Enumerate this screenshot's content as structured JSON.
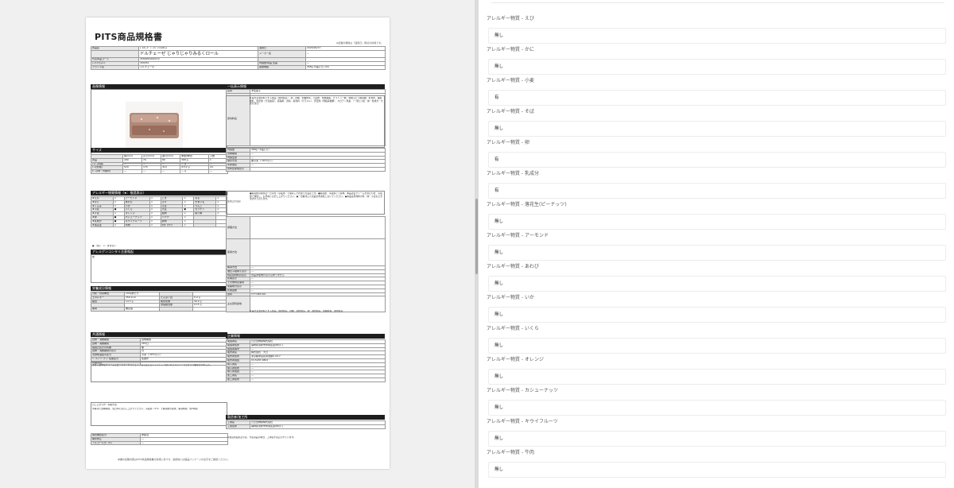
{
  "document": {
    "title": "PITS商品規格書",
    "header_note": "※記載の規格は「適用日」時点の情報です。",
    "header_rows": [
      {
        "l1": "商品名",
        "v1": "ﾄﾞﾙﾁｪｰｾﾞ ｼﾞｬﾘｼﾞｬﾘﾐﾙｸﾛｰﾙ",
        "l2": "適用日",
        "v2": "2025/09/17"
      },
      {
        "l1": "",
        "v1": "ドルチェーゼ じゃりじゃりみるくロール",
        "l2": "メーカー名",
        "v2": "―"
      },
      {
        "l1": "代表商品コード",
        "v1": "4589950000072",
        "l2": "",
        "v2": ""
      },
      {
        "l1": "ﾒｰｶｰｱｲﾃﾑｺｰﾄﾞ",
        "v1": "300031",
        "l2": "内容量/商品 企画",
        "v2": "―"
      },
      {
        "l1": "ブランド名",
        "v1": "ドルチェーゼ",
        "l2": "容量規格",
        "v2": "368g (1個入り) /24"
      }
    ],
    "sections": {
      "image": "画像情報",
      "size": "サイズ",
      "allergen": "アレルギー物質情報（★：推奨表示）",
      "contam": "アレルゲンコンタミ注意喚起",
      "nutrition": "栄養成分情報",
      "shared": "共通情報",
      "general": "一括表示情報",
      "company": "企業情報",
      "maker": "製造者/加工所"
    },
    "size_rows": [
      [
        "",
        "幅(mm)",
        "高さ(mm)",
        "奥行(mm)",
        "重量(単位)",
        "入数"
      ],
      [
        "商品",
        "180",
        "70",
        "80",
        "368 g",
        "1"
      ],
      [
        "ｲﾝﾅｰ(中箱)",
        "―",
        "―",
        "―",
        "― g",
        "―"
      ],
      [
        "ｹｰｽ(外箱)",
        "520",
        "170",
        "410",
        "9712 g",
        "24"
      ],
      [
        "ﾎﾞｰﾙ(中・外箱外)",
        "―",
        "―",
        "―",
        "― g",
        "―"
      ]
    ],
    "allergen_rows": [
      [
        "★えび",
        "×",
        "アーモンド",
        "×",
        "ごま",
        "×",
        "もも",
        "×"
      ],
      [
        "★かに",
        "×",
        "あわび",
        "×",
        "さけ",
        "×",
        "やまいも",
        "×"
      ],
      [
        "★くるみ",
        "×",
        "いか",
        "×",
        "さば",
        "×",
        "りんご",
        "×"
      ],
      [
        "★小麦",
        "●",
        "いくら",
        "×",
        "大豆",
        "●",
        "ゼラチン",
        "×"
      ],
      [
        "★そば",
        "×",
        "オレンジ",
        "×",
        "鶏肉",
        "×",
        "魚介類",
        "×"
      ],
      [
        "★卵",
        "●",
        "カシューナッツ",
        "×",
        "バナナ",
        "×",
        "",
        ""
      ],
      [
        "★乳成分",
        "●",
        "キウイフルーツ",
        "×",
        "豚肉",
        "×",
        "",
        ""
      ],
      [
        "★落花生",
        "×",
        "牛肉",
        "×",
        "ﾏｶﾀﾞﾐｱﾅｯﾂ",
        "×",
        "",
        ""
      ]
    ],
    "allergen_legend": "●：含む　×：含まない",
    "contam_text": "無",
    "nutrition_rows": [
      [
        "分析・計算単位",
        "100gあたり",
        "",
        ""
      ],
      [
        "エネルギー",
        "356 kcal",
        "たんぱく質",
        "5.9 g"
      ],
      [
        "脂質",
        "14.3 g",
        "炭水化物",
        "39.4 g"
      ],
      [
        "",
        "",
        "食塩相当量",
        "0.15 g"
      ],
      [
        "備考",
        "推定値",
        "",
        ""
      ]
    ],
    "shared_rows": [
      [
        "賞味・消費期限",
        "賞味期限"
      ],
      [
        "賞味・消費期間",
        "365日"
      ],
      [
        "製造日表示の有無",
        "無"
      ],
      [
        "賞味・消費期限の表示",
        "月"
      ],
      [
        "流通時温度帯区分",
        "冷凍（-18℃以下）"
      ],
      [
        "ﾊﾞｰｺｰﾄﾞﾊﾟｯｹｰｼﾞ在庫区分",
        "在庫外"
      ],
      [
        "商品特徴",
        ""
      ]
    ],
    "shared_feature": "あまく濃厚なクリームとロールケーキでシュッ、ほろほろとシャリシャリ甘いカラメルソースとザラメ糖をかけました。",
    "shared_note_label": "召し上がり方・利用方法",
    "shared_note": "半解凍で賞味期限、当日中にお召し上がりください。冷蔵庫（4℃）で解凍後の提供：解凍時間　約3時間",
    "shared_bottom": [
      [
        "保管推奨区分",
        "非該当"
      ],
      [
        "酸化防止",
        "―"
      ],
      [
        "アルコール分（%）",
        "―"
      ]
    ],
    "general_rows": [
      [
        "名称",
        "洋生菓子"
      ],
      [
        "原材料名",
        ""
      ]
    ],
    "ingredients": "乳等を主要原料とする食品（国内製造）、卵、砂糖、加糖卵黄、小麦粉、植物油脂、グラニュー糖、果糖ぶどう糖液糖、水あめ、脱脂粉乳、乳化剤（大豆由来）、膨張剤、香料、着色料（カラメル）、安定剤（増粘多糖類）、カロテン色素、（一部に小麦・卵・乳成分・大豆を含む）",
    "general_rows2": [
      [
        "内容量",
        "368g（1個入り）"
      ],
      [
        "賞味期限",
        "―"
      ],
      [
        "内容生産",
        "―"
      ],
      [
        "保存方法",
        "要冷凍（-18℃以下）"
      ],
      [
        "原産国名",
        "―"
      ],
      [
        "原料原産地表示",
        ""
      ]
    ],
    "caution_label": "使用上の注意",
    "caution_text": "●解凍後の提供は一日以内（冷蔵庫）で保存した状態での設定です。●解凍後、冷蔵庫にて賞味、本品は生クリームを含むため、冷蔵庫で保管し、お早めにお召し上がりください。●一旦解凍した商品を再凍結しないでください。●本品は原材料の乳・卵・小麦などが含まれております。",
    "general_rows3": [
      [
        "調理方法",
        ""
      ],
      [
        "使用方法",
        ""
      ],
      [
        "解凍方法",
        "―"
      ],
      [
        "遺伝子組換え表示",
        "―"
      ],
      [
        "特定原材料の表示",
        "食品添加物の表示はありません"
      ],
      [
        "乳等表示",
        "―"
      ],
      [
        "その他特定事項",
        "―"
      ],
      [
        "栄養成分表示",
        "―"
      ],
      [
        "乳酸菌数",
        "―"
      ],
      [
        "原料",
        "TYYY.MM.DD"
      ],
      [
        "主な原料産地",
        ""
      ]
    ],
    "origin_text": "乳等を主要原料とする食品：国内製造、砂糖：国内製造、卵：国内製造、加糖卵黄：国内製造",
    "company_rows": [
      [
        "製造者名",
        "日之出物産株式会社"
      ],
      [
        "製造者住所",
        "静岡県浜松市中央区苗木町1丁"
      ],
      [
        "製造者番号",
        "―"
      ],
      [
        "販売者名",
        "株式会社　大日"
      ],
      [
        "販売者住所",
        "東京都豊島区南池袋2-29-7"
      ],
      [
        "販売者電話",
        "03-5287-9802"
      ],
      [
        "輸入者名",
        "―"
      ],
      [
        "輸入者住所",
        "―"
      ],
      [
        "輸入者電話",
        "―"
      ],
      [
        "加工者名",
        "―"
      ],
      [
        "加工者住所",
        "―"
      ]
    ],
    "maker_rows": [
      [
        "工場名",
        "日之出物産株式会社"
      ],
      [
        "工場住所",
        "静岡県浜松市中央区苗木町1丁"
      ]
    ],
    "maker_note": "※製造所固有記号は、代表商品の場合、工場名が表記されています。",
    "footer": "本書の記載内容はPITS商品規格書の情報に基づき、最終的には製品パッケージの表示をご確認ください。"
  },
  "form": {
    "fields": [
      {
        "label": "アレルギー物質 - えび",
        "value": "無し"
      },
      {
        "label": "アレルギー物質 - かに",
        "value": "無し"
      },
      {
        "label": "アレルギー物質 - 小麦",
        "value": "有"
      },
      {
        "label": "アレルギー物質 - そば",
        "value": "無し"
      },
      {
        "label": "アレルギー物質 - 卵",
        "value": "有"
      },
      {
        "label": "アレルギー物質 - 乳成分",
        "value": "有"
      },
      {
        "label": "アレルギー物質 - 落花生(ピーナッツ)",
        "value": "無し"
      },
      {
        "label": "アレルギー物質 - アーモンド",
        "value": "無し"
      },
      {
        "label": "アレルギー物質 - あわび",
        "value": "無し"
      },
      {
        "label": "アレルギー物質 - いか",
        "value": "無し"
      },
      {
        "label": "アレルギー物質 - いくら",
        "value": "無し"
      },
      {
        "label": "アレルギー物質 - オレンジ",
        "value": "無し"
      },
      {
        "label": "アレルギー物質 - カシューナッツ",
        "value": "無し"
      },
      {
        "label": "アレルギー物質 - キウイフルーツ",
        "value": "無し"
      },
      {
        "label": "アレルギー物質 - 牛肉",
        "value": "無し"
      }
    ]
  }
}
